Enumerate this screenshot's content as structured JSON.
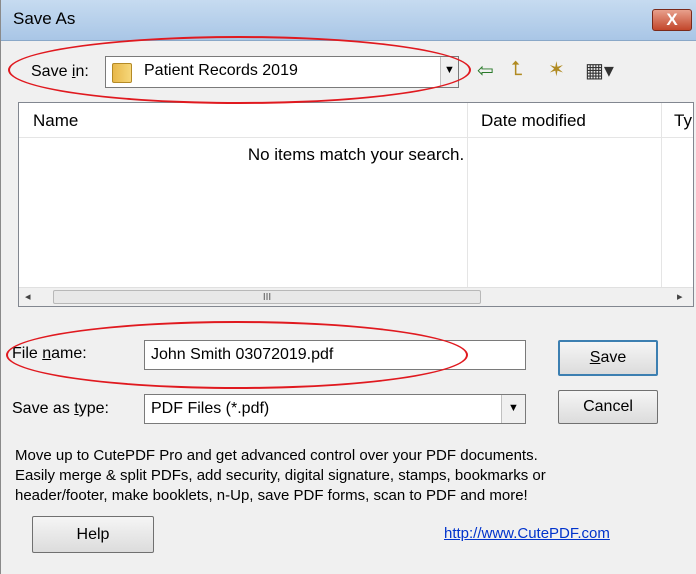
{
  "window": {
    "title": "Save As",
    "close_glyph": "X"
  },
  "save_in": {
    "label_pre": "Save ",
    "label_accel": "i",
    "label_post": "n:",
    "value": "Patient Records 2019",
    "folder_icon": "folder-icon",
    "dropdown_glyph": "▼"
  },
  "toolbar": {
    "back_glyph": "⇦",
    "up_glyph": "⮤",
    "newfolder_glyph": "✶",
    "views_glyph": "▦▾"
  },
  "file_list": {
    "columns": [
      "Name",
      "Date modified",
      "Ty"
    ],
    "empty_message": "No items match your search.",
    "scroll_left": "◂",
    "scroll_right": "▸",
    "thumb_grip": "III"
  },
  "file_name": {
    "label_pre": "File ",
    "label_accel": "n",
    "label_post": "ame:",
    "value": "John Smith 03072019.pdf"
  },
  "save_type": {
    "label_pre": "Save as ",
    "label_accel": "t",
    "label_post": "ype:",
    "value": "PDF Files (*.pdf)",
    "dropdown_glyph": "▼"
  },
  "buttons": {
    "save_accel": "S",
    "save_rest": "ave",
    "cancel": "Cancel",
    "help": "Help"
  },
  "promo": {
    "line1": "Move up to CutePDF Pro and get advanced control over your PDF documents.",
    "line2": "Easily merge & split PDFs, add security, digital signature, stamps, bookmarks or",
    "line3": "header/footer, make booklets, n-Up, save PDF forms, scan to PDF and more!"
  },
  "link": {
    "text": "http://www.CutePDF.com"
  },
  "colors": {
    "annotation": "#e0191f",
    "link": "#0033cc"
  }
}
